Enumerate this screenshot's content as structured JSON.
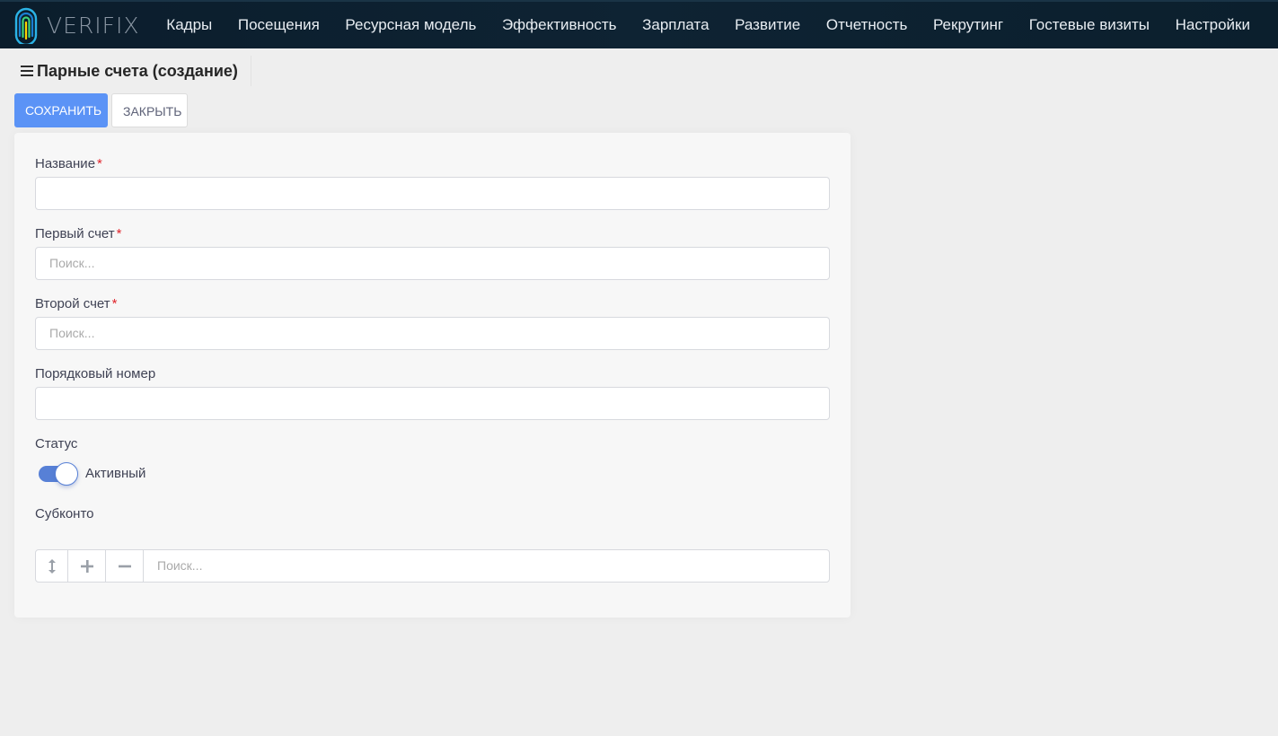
{
  "brand": {
    "logo_text": "VERIFIX",
    "icon": "fingerprint-logo-icon",
    "colors": [
      "#2bb3e6",
      "#ffd400",
      "#3fd27a"
    ]
  },
  "nav": {
    "items": [
      {
        "label": "Кадры"
      },
      {
        "label": "Посещения"
      },
      {
        "label": "Ресурсная модель"
      },
      {
        "label": "Эффективность"
      },
      {
        "label": "Зарплата"
      },
      {
        "label": "Развитие"
      },
      {
        "label": "Отчетность"
      },
      {
        "label": "Рекрутинг"
      },
      {
        "label": "Гостевые визиты"
      },
      {
        "label": "Настройки"
      }
    ]
  },
  "page": {
    "title": "Парные счета (создание)",
    "menu_icon": "hamburger-icon"
  },
  "actions": {
    "save_label": "СОХРАНИТЬ",
    "close_label": "ЗАКРЫТЬ",
    "primary_color": "#5b93f6"
  },
  "form": {
    "name": {
      "label": "Название",
      "required_mark": "*",
      "value": ""
    },
    "first_account": {
      "label": "Первый счет",
      "required_mark": "*",
      "placeholder": "Поиск..."
    },
    "second_account": {
      "label": "Второй счет",
      "required_mark": "*",
      "placeholder": "Поиск..."
    },
    "order_number": {
      "label": "Порядковый номер",
      "value": ""
    },
    "status": {
      "label": "Статус",
      "toggle_label": "Активный",
      "checked": true,
      "color": "#5780d6"
    },
    "subconto": {
      "label": "Субконто",
      "sort_icon": "sort-vertical-icon",
      "add_icon": "plus-icon",
      "remove_icon": "minus-icon",
      "placeholder": "Поиск..."
    }
  }
}
